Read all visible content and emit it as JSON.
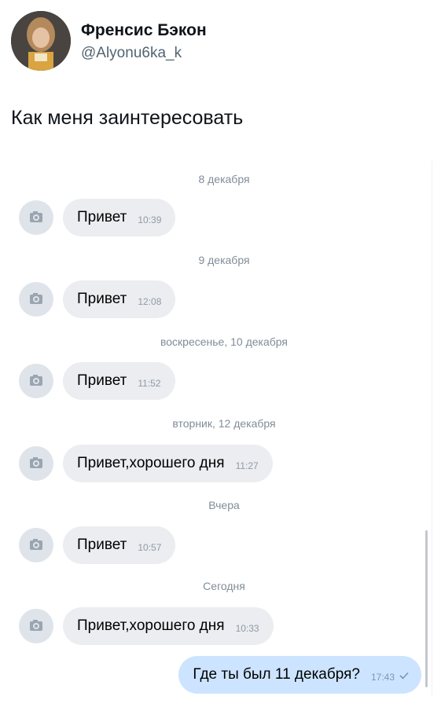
{
  "tweet": {
    "author_name": "Френсис Бэкон",
    "author_handle": "@Alyonu6ka_k",
    "text": "Как меня заинтересовать"
  },
  "chat": {
    "messages": [
      {
        "date": "8 декабря",
        "text": "Привет",
        "time": "10:39"
      },
      {
        "date": "9 декабря",
        "text": "Привет",
        "time": "12:08"
      },
      {
        "date": "воскресенье, 10 декабря",
        "text": "Привет",
        "time": "11:52"
      },
      {
        "date": "вторник, 12 декабря",
        "text": "Привет,хорошего дня",
        "time": "11:27"
      },
      {
        "date": "Вчера",
        "text": "Привет",
        "time": "10:57"
      },
      {
        "date": "Сегодня",
        "text": "Привет,хорошего дня",
        "time": "10:33"
      }
    ],
    "outgoing": {
      "text": "Где ты был 11 декабря?",
      "time": "17:43",
      "status_icon": "read-check-icon"
    }
  },
  "colors": {
    "incoming_bubble": "#ebedf0",
    "outgoing_bubble": "#cce4ff",
    "date_text": "#818c99"
  }
}
